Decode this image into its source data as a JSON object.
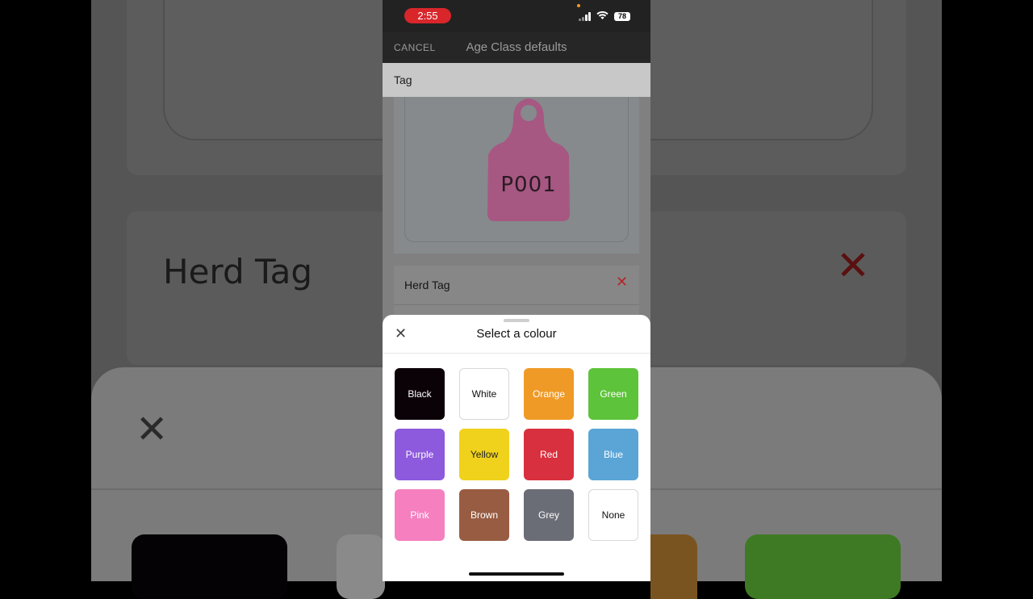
{
  "status_bar": {
    "time": "2:55",
    "battery": "78"
  },
  "nav": {
    "cancel_label": "CANCEL",
    "title": "Age Class defaults"
  },
  "tag_section": {
    "header": "Tag",
    "tag_number": "P001",
    "tag_color": "#d85ea4"
  },
  "herd_tag": {
    "label": "Herd Tag"
  },
  "colour_sheet": {
    "title": "Select a colour",
    "swatches": [
      {
        "label": "Black",
        "color": "#0b0208",
        "text_color": "#ffffff"
      },
      {
        "label": "White",
        "color": "#ffffff",
        "text_color": "#111111"
      },
      {
        "label": "Orange",
        "color": "#ef9a26",
        "text_color": "#ffffff"
      },
      {
        "label": "Green",
        "color": "#5dc33a",
        "text_color": "#ffffff"
      },
      {
        "label": "Purple",
        "color": "#8d59dd",
        "text_color": "#ffffff"
      },
      {
        "label": "Yellow",
        "color": "#f0d21d",
        "text_color": "#222222"
      },
      {
        "label": "Red",
        "color": "#d8303e",
        "text_color": "#ffffff"
      },
      {
        "label": "Blue",
        "color": "#5aa5d6",
        "text_color": "#ffffff"
      },
      {
        "label": "Pink",
        "color": "#f57fbf",
        "text_color": "#ffffff"
      },
      {
        "label": "Brown",
        "color": "#985c42",
        "text_color": "#ffffff"
      },
      {
        "label": "Grey",
        "color": "#6a6c76",
        "text_color": "#ffffff"
      },
      {
        "label": "None",
        "color": "#ffffff",
        "text_color": "#111111"
      }
    ]
  },
  "background": {
    "herd_tag_label": "Herd Tag"
  }
}
